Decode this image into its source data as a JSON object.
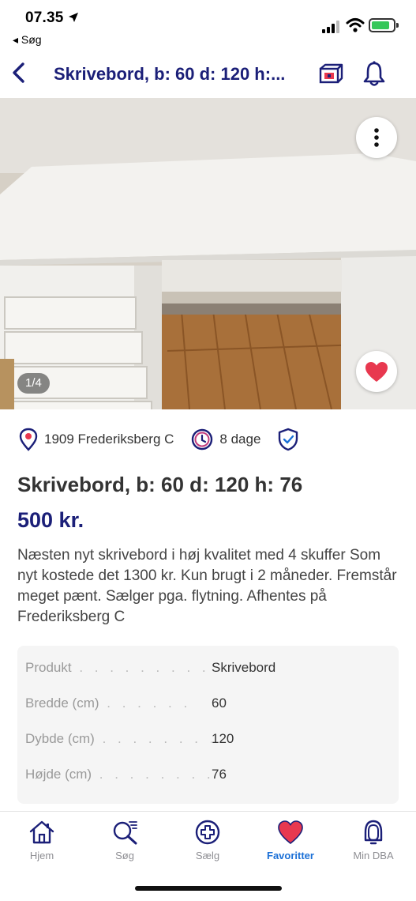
{
  "status_bar": {
    "time": "07.35",
    "back_app": "◂ Søg",
    "battery_color": "#35c759"
  },
  "header": {
    "title": "Skrivebord, b: 60 d: 120 h:...",
    "back_icon": "chevron-left-icon",
    "promo_icon": "promote-icon",
    "bell_icon": "bell-icon",
    "accent_color": "#1b1f78"
  },
  "gallery": {
    "counter": "1/4",
    "more_icon": "more-vertical-icon",
    "favorite_icon": "heart-icon",
    "favorite_color": "#e8384f"
  },
  "meta": {
    "location": "1909 Frederiksberg C",
    "age": "8 dage",
    "location_icon": "location-pin-icon",
    "clock_icon": "clock-icon",
    "verified_icon": "shield-check-icon"
  },
  "listing": {
    "title": "Skrivebord, b: 60 d: 120 h: 76",
    "price": "500 kr.",
    "description": "Næsten nyt skrivebord i høj kvalitet med 4 skuffer Som nyt kostede det 1300 kr. Kun brugt i 2 måneder. Fremstår meget pænt. Sælger pga. flytning. Afhentes på Frederiksberg C"
  },
  "specs": [
    {
      "label": "Produkt",
      "value": "Skrivebord"
    },
    {
      "label": "Bredde (cm)",
      "value": "60"
    },
    {
      "label": "Dybde (cm)",
      "value": "120"
    },
    {
      "label": "Højde (cm)",
      "value": "76"
    }
  ],
  "tabbar": {
    "active_color": "#1a6fd6",
    "tabs": [
      {
        "label": "Hjem",
        "icon": "home-icon"
      },
      {
        "label": "Søg",
        "icon": "search-icon"
      },
      {
        "label": "Sælg",
        "icon": "plus-circle-icon"
      },
      {
        "label": "Favoritter",
        "icon": "heart-icon"
      },
      {
        "label": "Min DBA",
        "icon": "profile-icon"
      }
    ]
  }
}
